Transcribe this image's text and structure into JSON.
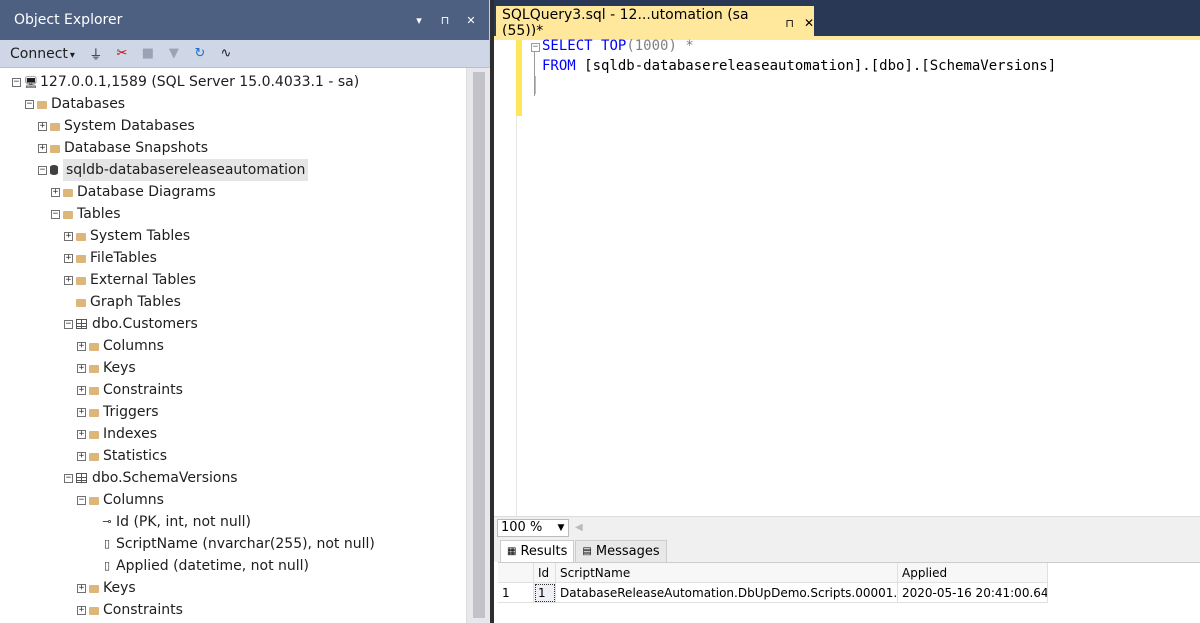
{
  "object_explorer": {
    "title": "Object Explorer",
    "title_buttons": [
      "▾",
      "⊓",
      "✕"
    ],
    "toolbar": {
      "connect_label": "Connect",
      "connect_dropdown": "▾"
    }
  },
  "tree": {
    "server": "127.0.0.1,1589 (SQL Server 15.0.4033.1 - sa)",
    "databases": "Databases",
    "system_databases": "System Databases",
    "database_snapshots": "Database Snapshots",
    "db": "sqldb-databasereleaseautomation",
    "database_diagrams": "Database Diagrams",
    "tables": "Tables",
    "system_tables": "System Tables",
    "filetables": "FileTables",
    "external_tables": "External Tables",
    "graph_tables": "Graph Tables",
    "customers": "dbo.Customers",
    "cust_columns": "Columns",
    "cust_keys": "Keys",
    "cust_constraints": "Constraints",
    "cust_triggers": "Triggers",
    "cust_indexes": "Indexes",
    "cust_statistics": "Statistics",
    "schemaversions": "dbo.SchemaVersions",
    "sv_columns": "Columns",
    "col_id": "Id (PK, int, not null)",
    "col_scriptname": "ScriptName (nvarchar(255), not null)",
    "col_applied": "Applied (datetime, not null)",
    "sv_keys": "Keys",
    "sv_constraints": "Constraints"
  },
  "editor": {
    "tab_title": "SQLQuery3.sql - 12...utomation (sa (55))*",
    "tab_pin": "⊓",
    "tab_close": "✕",
    "line1": {
      "kw1": "SELECT",
      "kw2": "TOP",
      "paren": "(1000)",
      "star": " *"
    },
    "line2": {
      "kw": "FROM",
      "text": " [sqldb-databasereleaseautomation].[dbo].[SchemaVersions]"
    },
    "zoom": "100 %"
  },
  "results": {
    "tabs": [
      "Results",
      "Messages"
    ],
    "columns": [
      "Id",
      "ScriptName",
      "Applied"
    ],
    "rows": [
      {
        "row_num": "1",
        "id": "1",
        "script_name": "DatabaseReleaseAutomation.DbUpDemo.Scripts.00001...",
        "applied": "2020-05-16 20:41:00.640"
      }
    ]
  }
}
